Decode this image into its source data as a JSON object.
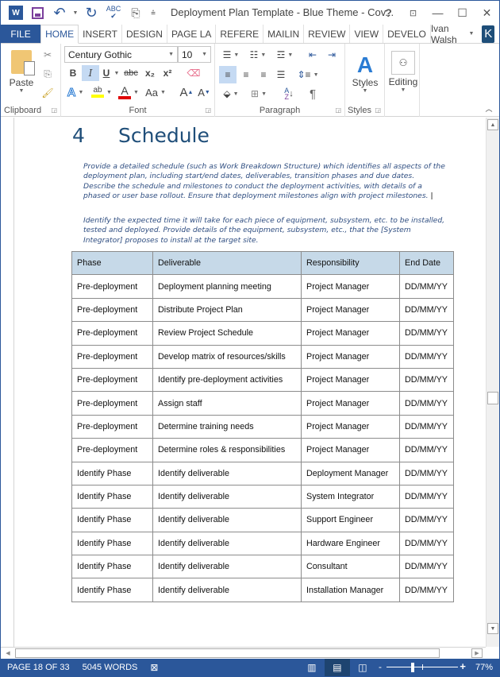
{
  "app": {
    "title": "Deployment Plan Template - Blue Theme - Cov...",
    "logo_letter": "W",
    "help_label": "?",
    "user_name": "Ivan Walsh",
    "user_initial": "K"
  },
  "tabs": [
    {
      "label": "FILE"
    },
    {
      "label": "HOME",
      "active": true
    },
    {
      "label": "INSERT"
    },
    {
      "label": "DESIGN"
    },
    {
      "label": "PAGE LA"
    },
    {
      "label": "REFERE"
    },
    {
      "label": "MAILIN"
    },
    {
      "label": "REVIEW"
    },
    {
      "label": "VIEW"
    },
    {
      "label": "DEVELO"
    }
  ],
  "ribbon": {
    "clipboard": {
      "label": "Clipboard",
      "paste_label": "Paste"
    },
    "font": {
      "label": "Font",
      "font_name": "Century Gothic",
      "font_size": "10",
      "bold": "B",
      "italic": "I",
      "underline": "U",
      "strike": "abc",
      "subscript": "x₂",
      "superscript": "x²",
      "case": "Aa",
      "grow": "A",
      "shrink": "A",
      "text_effects": "A",
      "highlight": "ab",
      "font_color": "A",
      "highlight_color": "#ffff00",
      "font_color_value": "#e00000"
    },
    "paragraph": {
      "label": "Paragraph",
      "pilcrow": "¶"
    },
    "styles": {
      "label": "Styles",
      "button_label": "Styles"
    },
    "editing": {
      "button_label": "Editing"
    }
  },
  "document": {
    "heading_number": "4",
    "heading_text": "Schedule",
    "paragraph1": "Provide a detailed schedule (such as Work Breakdown Structure) which identifies all aspects of the deployment plan, including start/end dates, deliverables, transition phases and due dates. Describe the schedule and milestones to conduct the deployment activities, with details of a phased or user base rollout. Ensure that deployment milestones align with project milestones.",
    "paragraph2": "Identify the expected time it will take for each piece of equipment, subsystem, etc. to be installed, tested and deployed. Provide details of the equipment, subsystem, etc., that the [System Integrator] proposes to install at the target site.",
    "table": {
      "header_color": "#c6d9e8",
      "columns": [
        "Phase",
        "Deliverable",
        "Responsibility",
        "End Date"
      ],
      "rows": [
        [
          "Pre-deployment",
          "Deployment planning meeting",
          "Project Manager",
          "DD/MM/YY"
        ],
        [
          "Pre-deployment",
          "Distribute Project Plan",
          "Project Manager",
          "DD/MM/YY"
        ],
        [
          "Pre-deployment",
          "Review Project Schedule",
          "Project Manager",
          "DD/MM/YY"
        ],
        [
          "Pre-deployment",
          "Develop matrix of resources/skills",
          "Project Manager",
          "DD/MM/YY"
        ],
        [
          "Pre-deployment",
          "Identify pre-deployment activities",
          "Project Manager",
          "DD/MM/YY"
        ],
        [
          "Pre-deployment",
          "Assign staff",
          "Project Manager",
          "DD/MM/YY"
        ],
        [
          "Pre-deployment",
          "Determine training needs",
          "Project Manager",
          "DD/MM/YY"
        ],
        [
          "Pre-deployment",
          "Determine roles & responsibilities",
          "Project Manager",
          "DD/MM/YY"
        ],
        [
          "Identify Phase",
          "Identify deliverable",
          "Deployment Manager",
          "DD/MM/YY"
        ],
        [
          "Identify Phase",
          "Identify deliverable",
          "System Integrator",
          "DD/MM/YY"
        ],
        [
          "Identify Phase",
          "Identify deliverable",
          "Support Engineer",
          "DD/MM/YY"
        ],
        [
          "Identify Phase",
          "Identify deliverable",
          "Hardware Engineer",
          "DD/MM/YY"
        ],
        [
          "Identify Phase",
          "Identify deliverable",
          "Consultant",
          "DD/MM/YY"
        ],
        [
          "Identify Phase",
          "Identify deliverable",
          "Installation Manager",
          "DD/MM/YY"
        ]
      ]
    }
  },
  "status": {
    "page": "PAGE 18 OF 33",
    "words": "5045 WORDS",
    "zoom": "77%",
    "zoom_value_percent": 77,
    "brand_color": "#2b579a"
  }
}
